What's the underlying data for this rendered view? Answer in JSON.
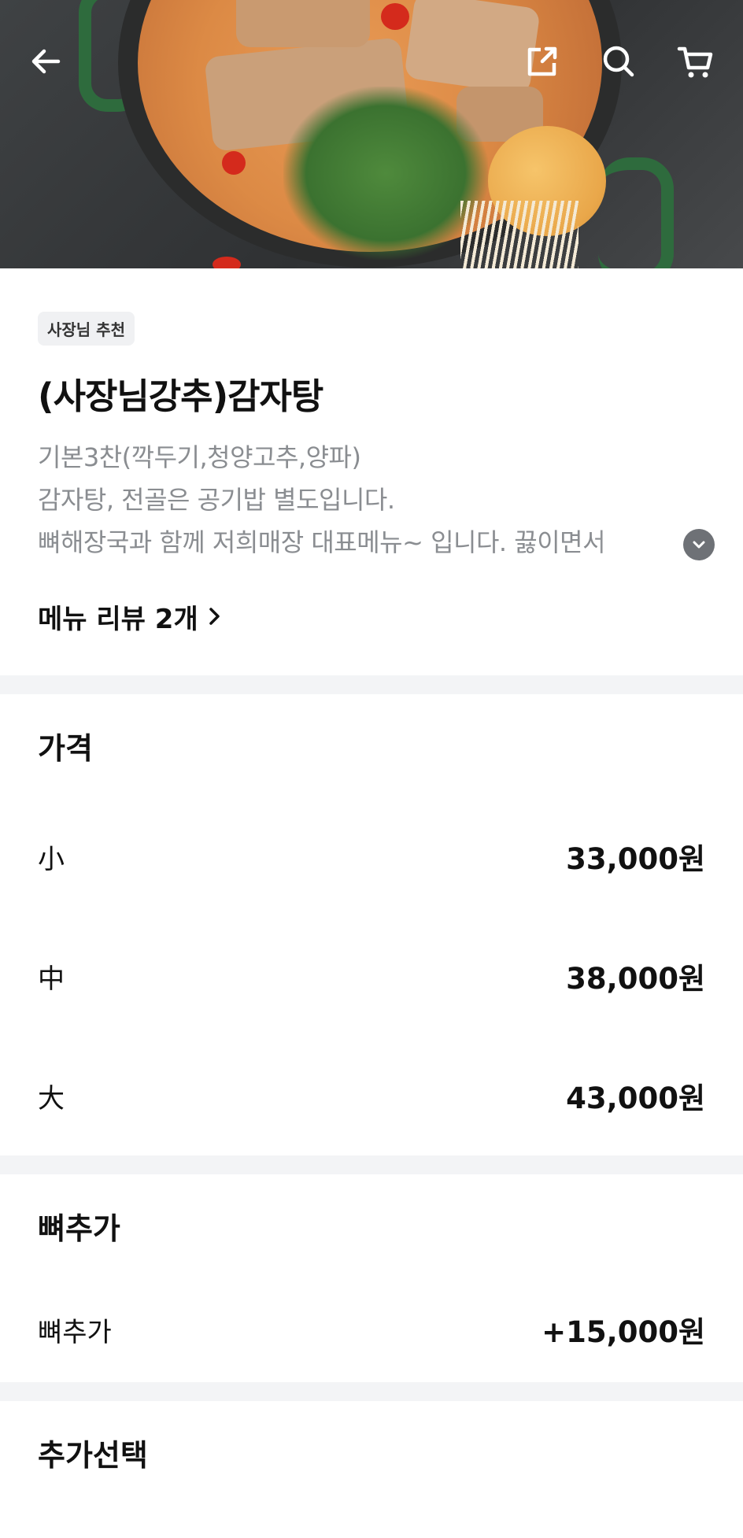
{
  "header": {
    "back_icon": "arrow-left-icon",
    "share_icon": "share-icon",
    "search_icon": "search-icon",
    "cart_icon": "cart-icon"
  },
  "menu": {
    "badge": "사장님 추천",
    "title": "(사장님강추)감자탕",
    "description": [
      "기본3찬(깍두기,청양고추,양파)",
      "감자탕, 전골은 공기밥 별도입니다.",
      "뼈해장국과 함께 저희매장 대표메뉴~ 입니다. 끓이면서"
    ],
    "review_link": "메뉴 리뷰 2개"
  },
  "price_group": {
    "title": "가격",
    "options": [
      {
        "label": "小",
        "price": "33,000원"
      },
      {
        "label": "中",
        "price": "38,000원"
      },
      {
        "label": "大",
        "price": "43,000원"
      }
    ]
  },
  "extra_bone_group": {
    "title": "뼈추가",
    "options": [
      {
        "label": "뼈추가",
        "price": "+15,000원"
      }
    ]
  },
  "additional_group": {
    "title": "추가선택"
  },
  "colors": {
    "accent_badge_bg": "#f0f1f3",
    "divider": "#f3f4f6",
    "description_text": "#8a8d91"
  }
}
